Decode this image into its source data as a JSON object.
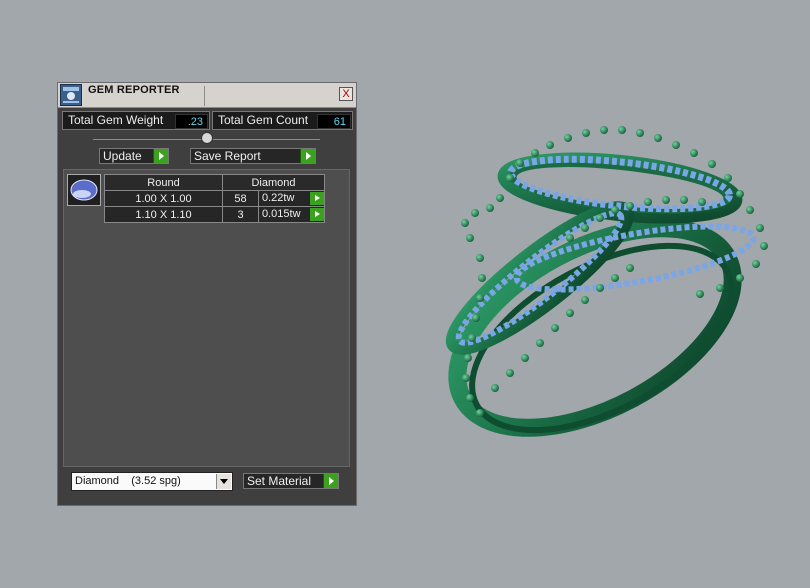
{
  "panel": {
    "title": "GEM REPORTER",
    "close_glyph": "X",
    "total_gem_weight_label": "Total Gem Weight",
    "total_gem_weight_value": ".23",
    "total_gem_count_label": "Total Gem Count",
    "total_gem_count_value": "61",
    "update_label": "Update",
    "save_report_label": "Save Report",
    "table": {
      "headers": [
        "Round",
        "Diamond"
      ],
      "rows": [
        {
          "size": "1.00 X 1.00",
          "count": "58",
          "weight": "0.22tw"
        },
        {
          "size": "1.10 X 1.10",
          "count": "3",
          "weight": "0.015tw"
        }
      ]
    },
    "material_selected": "Diamond    (3.52 spg)",
    "set_material_label": "Set Material"
  },
  "colors": {
    "viewport_bg": "#a2a7ac",
    "ring_metal": "#1e7a4e",
    "gem_blue": "#7aa6e6",
    "accent_green": "#3aa21f"
  },
  "icons": {
    "title_icon": "gem-reporter-app-icon",
    "gem_thumbnail": "round-gem-icon"
  }
}
